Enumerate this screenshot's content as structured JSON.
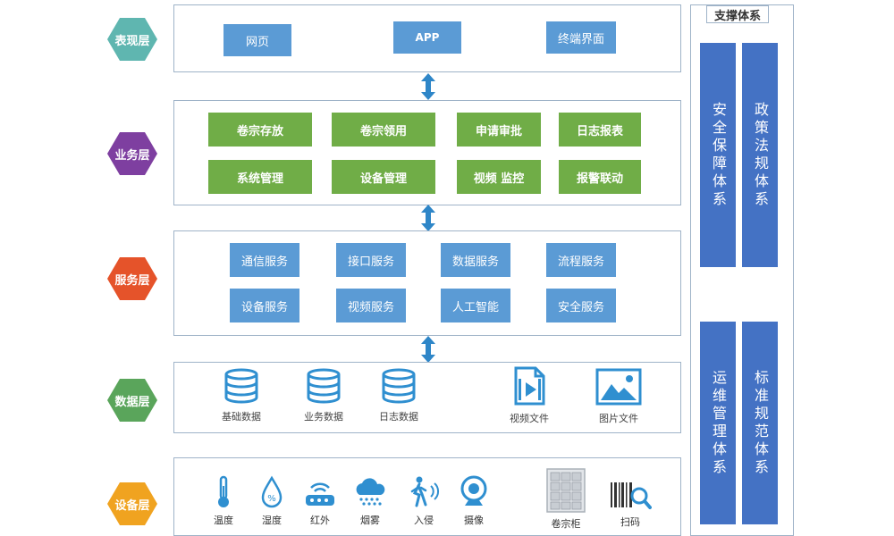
{
  "layers": {
    "presentation": "表现层",
    "business": "业务层",
    "service": "服务层",
    "data": "数据层",
    "device": "设备层"
  },
  "presentation_items": [
    "网页",
    "APP",
    "终端界面"
  ],
  "business_items": [
    "卷宗存放",
    "卷宗领用",
    "申请审批",
    "日志报表",
    "系统管理",
    "设备管理",
    "视频 监控",
    "报警联动"
  ],
  "service_items": [
    "通信服务",
    "接口服务",
    "数据服务",
    "流程服务",
    "设备服务",
    "视频服务",
    "人工智能",
    "安全服务"
  ],
  "data_items": [
    "基础数据",
    "业务数据",
    "日志数据",
    "视频文件",
    "图片文件"
  ],
  "device_items": [
    "温度",
    "湿度",
    "红外",
    "烟雾",
    "入侵",
    "摄像",
    "卷宗柜",
    "扫码"
  ],
  "support": {
    "title": "支撑体系",
    "blocks": [
      "安全保障体系",
      "政策法规体系",
      "运维管理体系",
      "标准规范体系"
    ]
  },
  "colors": {
    "presentation_hex": "#5fb6b0",
    "business_hex": "#7e3fa0",
    "service_hex": "#e5532a",
    "data_hex": "#5aa55b",
    "device_hex": "#f0a320",
    "blue_box": "#5b9bd5",
    "green_box": "#70ad47",
    "support_box": "#4472c4",
    "icon_blue": "#2f8fd0"
  }
}
